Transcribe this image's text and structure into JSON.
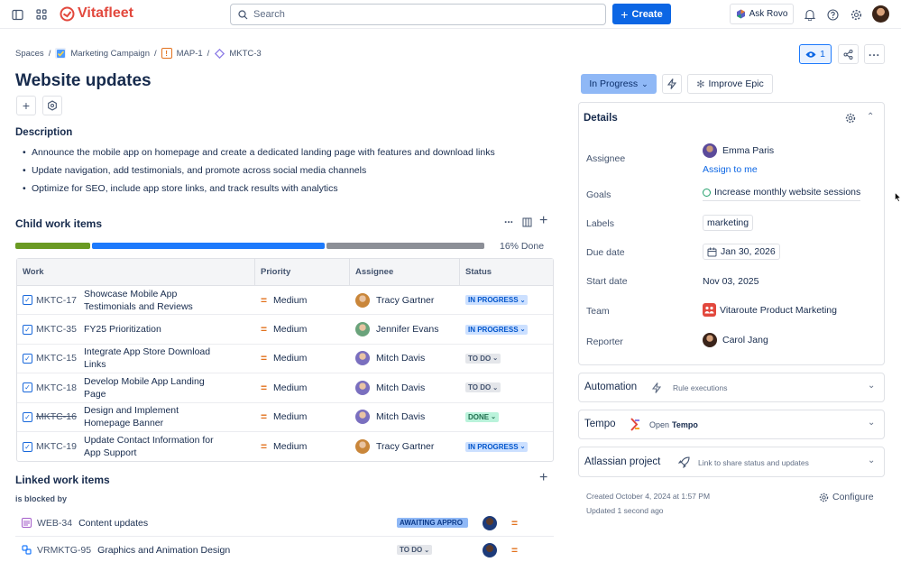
{
  "topbar": {
    "brand": "Vitafleet",
    "search_placeholder": "Search",
    "create_label": "Create",
    "ask_rovo_label": "Ask Rovo"
  },
  "breadcrumb": {
    "spaces": "Spaces",
    "project": "Marketing Campaign",
    "epic": "MAP-1",
    "issue": "MKTC-3"
  },
  "header": {
    "watch_count": "1"
  },
  "issue": {
    "title": "Website updates",
    "description_heading": "Description",
    "description_items": [
      "Announce the mobile app on homepage and create a dedicated landing page with features and download links",
      "Update navigation, add testimonials, and promote across social media channels",
      "Optimize for SEO, include app store links, and track results with analytics"
    ]
  },
  "child_items": {
    "heading": "Child work items",
    "progress_label": "16% Done",
    "progress": {
      "done": 0.16,
      "in_progress": 0.5,
      "todo": 0.34
    },
    "columns": [
      "Work",
      "Priority",
      "Assignee",
      "Status"
    ],
    "rows": [
      {
        "key": "MKTC-17",
        "summary": "Showcase Mobile App Testimonials and Reviews",
        "priority": "Medium",
        "assignee": "Tracy Gartner",
        "status": "IN PROGRESS",
        "avatar_color": "#c9863a"
      },
      {
        "key": "MKTC-35",
        "summary": "FY25 Prioritization",
        "priority": "Medium",
        "assignee": "Jennifer Evans",
        "status": "IN PROGRESS",
        "avatar_color": "#6aa37b"
      },
      {
        "key": "MKTC-15",
        "summary": "Integrate App Store Download Links",
        "priority": "Medium",
        "assignee": "Mitch Davis",
        "status": "TO DO",
        "avatar_color": "#7a6fbf"
      },
      {
        "key": "MKTC-18",
        "summary": "Develop Mobile App Landing Page",
        "priority": "Medium",
        "assignee": "Mitch Davis",
        "status": "TO DO",
        "avatar_color": "#7a6fbf"
      },
      {
        "key": "MKTC-16",
        "summary": "Design and Implement Homepage Banner",
        "priority": "Medium",
        "assignee": "Mitch Davis",
        "status": "DONE",
        "avatar_color": "#7a6fbf"
      },
      {
        "key": "MKTC-19",
        "summary": "Update Contact Information for App Support",
        "priority": "Medium",
        "assignee": "Tracy Gartner",
        "status": "IN PROGRESS",
        "avatar_color": "#c9863a"
      }
    ]
  },
  "linked_items": {
    "heading": "Linked work items",
    "relation": "is blocked by",
    "rows": [
      {
        "key": "WEB-34",
        "summary": "Content updates",
        "status": "AWAITING APPRO"
      },
      {
        "key": "VRMKTG-95",
        "summary": "Graphics and Animation Design",
        "status": "TO DO"
      }
    ]
  },
  "sidebar": {
    "status": "In Progress",
    "improve_label": "Improve Epic",
    "details_heading": "Details",
    "labels": {
      "assignee": "Assignee",
      "goals": "Goals",
      "labels": "Labels",
      "due_date": "Due date",
      "start_date": "Start date",
      "team": "Team",
      "reporter": "Reporter"
    },
    "values": {
      "assignee": "Emma Paris",
      "assign_to_me": "Assign to me",
      "goal": "Increase monthly website sessions",
      "label": "marketing",
      "due_date": "Jan 30, 2026",
      "start_date": "Nov 03, 2025",
      "team": "Vitaroute Product Marketing",
      "reporter": "Carol Jang"
    },
    "automation": {
      "title": "Automation",
      "subtitle": "Rule executions"
    },
    "tempo": {
      "title": "Tempo",
      "open_prefix": "Open",
      "open_app": "Tempo"
    },
    "atlassian": {
      "title": "Atlassian project",
      "subtitle": "Link to share status and updates"
    },
    "created": "Created October 4, 2024 at 1:57 PM",
    "updated": "Updated 1 second ago",
    "configure_label": "Configure"
  },
  "colors": {
    "primary": "#0c66e4",
    "brand": "#e2483d",
    "progress_done": "#6a9a23",
    "progress_in_progress": "#1d7afc",
    "progress_todo": "#8c8f97"
  }
}
